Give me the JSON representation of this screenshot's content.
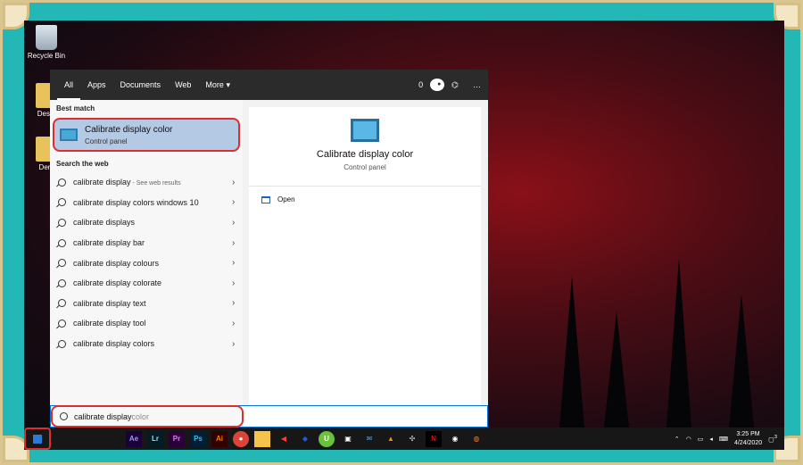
{
  "desktop": {
    "recycle_bin": "Recycle Bin",
    "desktop_folder": "Deskt",
    "demo_folder": "Dem"
  },
  "start_menu": {
    "tabs": [
      "All",
      "Apps",
      "Documents",
      "Web",
      "More"
    ],
    "more_chevron": "▾",
    "points": "0",
    "best_match_title": "Best match",
    "best_match": {
      "name": "Calibrate display color",
      "category": "Control panel"
    },
    "web_title": "Search the web",
    "results": [
      {
        "text": "calibrate display",
        "suffix": " - See web results"
      },
      {
        "text": "calibrate display colors windows 10",
        "suffix": ""
      },
      {
        "text": "calibrate displays",
        "suffix": ""
      },
      {
        "text": "calibrate display bar",
        "suffix": ""
      },
      {
        "text": "calibrate display colours",
        "suffix": ""
      },
      {
        "text": "calibrate display colorate",
        "suffix": ""
      },
      {
        "text": "calibrate display text",
        "suffix": ""
      },
      {
        "text": "calibrate display tool",
        "suffix": ""
      },
      {
        "text": "calibrate display colors",
        "suffix": ""
      }
    ],
    "preview": {
      "title": "Calibrate display color",
      "category": "Control panel",
      "action": "Open"
    },
    "search": {
      "typed": "calibrate display",
      "ghost": "color"
    }
  },
  "taskbar": {
    "apps": [
      {
        "label": "Ae",
        "color": "#9999ff"
      },
      {
        "label": "Lr",
        "color": "#add5ec"
      },
      {
        "label": "Pr",
        "color": "#ea77ff"
      },
      {
        "label": "Ps",
        "color": "#31c5f0"
      },
      {
        "label": "Ai",
        "color": "#ff7c00"
      }
    ],
    "time": "3:25 PM",
    "date": "4/24/2020",
    "notifications": "3"
  }
}
